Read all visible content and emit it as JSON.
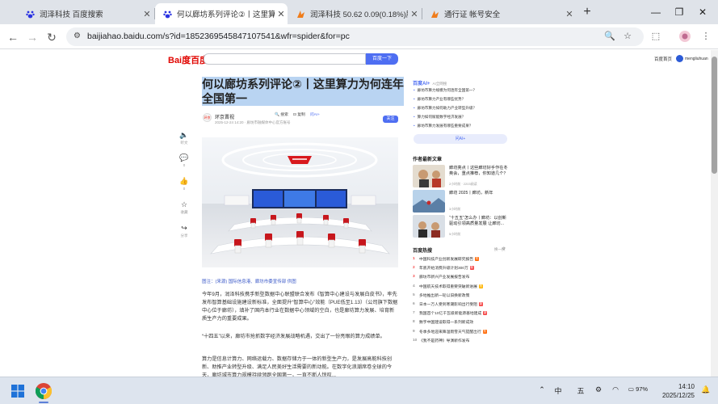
{
  "browser": {
    "tabs": [
      {
        "title": "润泽科技 百度搜索",
        "icon": "baidu-paw-icon",
        "active": false
      },
      {
        "title": "何以廊坊系列评论②丨这里算力",
        "icon": "baidu-paw-icon",
        "active": true
      },
      {
        "title": "润泽科技 50.62 0.09(0.18%)股",
        "icon": "stock-app-icon",
        "active": false
      },
      {
        "title": "通行证 帐号安全",
        "icon": "stock-app-icon",
        "active": false
      }
    ],
    "new_tab": "+",
    "window_controls": {
      "minimize": "—",
      "restore": "❐",
      "close": "✕"
    },
    "url": "baijiahao.baidu.com/s?id=1852369545847107541&wfr=spider&for=pc"
  },
  "baidu_header": {
    "logo": "Bai度百度",
    "search_button": "百度一下",
    "home_link": "百度首页",
    "user_name": "mengliuhuan"
  },
  "left_actions": [
    {
      "icon": "listen-icon",
      "label": "听文"
    },
    {
      "icon": "comment-icon",
      "label": "0"
    },
    {
      "icon": "like-icon",
      "label": "0"
    },
    {
      "icon": "collect-icon",
      "label": "收藏"
    },
    {
      "icon": "share-icon",
      "label": "分享"
    }
  ],
  "article": {
    "title": "何以廊坊系列评论②丨这里算力为何连年全国第一",
    "author": "环京晋视",
    "author_avatar_text": "环京",
    "meta": "2025-12-24 14:20 · 廊坊市融媒体中心官方账号",
    "tools": [
      "🔍 搜索",
      "⊡ 复制",
      "问AI+"
    ],
    "follow": "关注",
    "caption": "图注：(来源) 国际信息港、廊坊市委宣传部 供图",
    "paragraphs": [
      "今年9月，润泽科技携手新型数据中心联盟联合发布《智算中心建设与发展白皮书》，率先发布智算基础设施建设新标准，全面提升“智算中心”效能（PUE低至1.13）（公司旗下数据中心位于廊坊），填补了国内本行业在数据中心领域的空白，也是廊坊算力发展、培育新质生产力的重要成果。",
      "“十四五”以来，廊坊市抢抓数字经济发展战略机遇，交出了一份亮眼的算力成绩单。",
      "算力是信息计算力、网络运载力、数据存储力于一体的新型生产力，是发展高能科技创新、助推产业转型升级、满足人民美好生活需要的新动能。在数字化浪潮席卷全球的今天，廊坊城市算力规模持续领跑全国第一，一直不断人惊叹..."
    ]
  },
  "ai_panel": {
    "title": "百度AI+",
    "subtitle": "AI全网搜",
    "questions": [
      "廊坊市算力规模为何连年全国第一？",
      "廊坊市算力产业有哪些优势？",
      "廊坊市算力如何助力产业转型升级？",
      "算力如何赋能数字经济发展？",
      "廊坊市算力发展有哪些重要成果？"
    ],
    "ask_button": "问AI+"
  },
  "more_articles": {
    "title": "作者最新文章",
    "items": [
      {
        "title": "廊坊亮点丨这些廊坊好手作在冬奥会，重点推荐，你知道几个？",
        "meta": "2小时前 · 2203阅读"
      },
      {
        "title": "廊坊 2025丨廊坊，新年",
        "meta": "3小时前"
      },
      {
        "title": "“十五五”怎么办丨廊坊：以创新驱动引领高质量发展 让廊坊...",
        "meta": "5小时前"
      }
    ]
  },
  "hot_list": {
    "title": "百度热搜",
    "refresh": "换一换",
    "items": [
      {
        "rank": "1",
        "text": "中国科技产业创新发展研究报告",
        "badge": "热",
        "badge_color": "#ff6600"
      },
      {
        "rank": "2",
        "text": "年底开始消费升级计划300万",
        "badge": "新",
        "badge_color": "#f54545"
      },
      {
        "rank": "3",
        "text": "廊坊市新兴产业发展报告发布",
        "badge": "",
        "badge_color": ""
      },
      {
        "rank": "4",
        "text": "中国航天技术取得重要突破新进展",
        "badge": "热",
        "badge_color": "#ffb400"
      },
      {
        "rank": "5",
        "text": "多地推出新一轮以旧换新政策",
        "badge": "",
        "badge_color": ""
      },
      {
        "rank": "6",
        "text": "日本一万人受到寒潮影响出行受阻",
        "badge": "新",
        "badge_color": "#f54545"
      },
      {
        "rank": "7",
        "text": "我国首个10亿千瓦级新能源基地建成",
        "badge": "新",
        "badge_color": "#f54545"
      },
      {
        "rank": "8",
        "text": "数字中国建设取得一系列新成效",
        "badge": "",
        "badge_color": ""
      },
      {
        "rank": "9",
        "text": "冬季多地迎来降温雨雪天气提醒出行",
        "badge": "热",
        "badge_color": "#ff6600"
      },
      {
        "rank": "10",
        "text": "《我不是药神》导演新作发布",
        "badge": "",
        "badge_color": ""
      }
    ]
  },
  "taskbar": {
    "ime": "中",
    "ime_mode": "五",
    "battery": "97%",
    "time": "14:10",
    "date": "2025/12/25"
  }
}
